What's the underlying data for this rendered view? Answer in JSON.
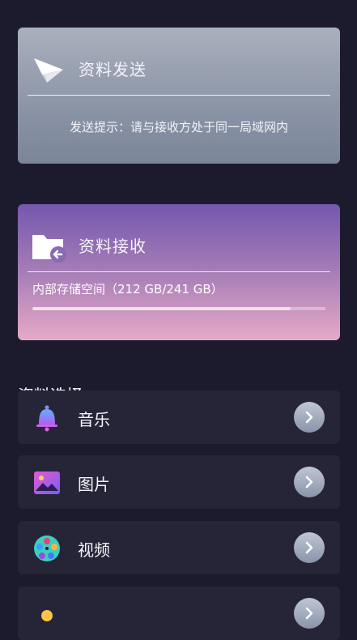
{
  "send_card": {
    "title": "资料发送",
    "hint": "发送提示：请与接收方处于同一局域网内"
  },
  "receive_card": {
    "title": "资料接收",
    "storage_text": "内部存储空间（212 GB/241 GB）",
    "storage_used_fraction": 0.88
  },
  "section": {
    "title": "资料选择"
  },
  "items": [
    {
      "label": "音乐",
      "icon": "bell-icon"
    },
    {
      "label": "图片",
      "icon": "image-icon"
    },
    {
      "label": "视频",
      "icon": "film-reel-icon"
    },
    {
      "label": "",
      "icon": "bulb-icon"
    }
  ],
  "colors": {
    "background": "#1c1b2e",
    "list_item": "#262538",
    "send_card": "#8b94a6",
    "receive_card_top": "#7457ad",
    "receive_card_bottom": "#e6aac7"
  }
}
